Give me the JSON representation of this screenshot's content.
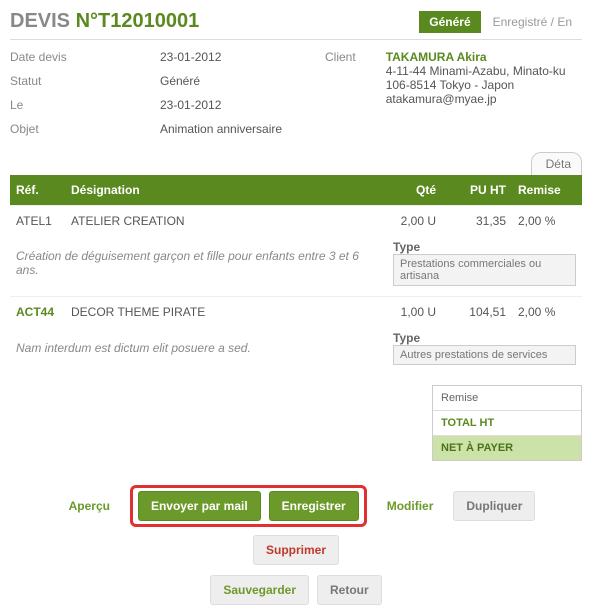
{
  "header": {
    "title_prefix": "DEVIS ",
    "title_number": "N°T12010001",
    "status_active": "Généré",
    "status_inactive": "Enregistré / En"
  },
  "meta": {
    "labels": {
      "date": "Date devis",
      "statut": "Statut",
      "le": "Le",
      "objet": "Objet",
      "client": "Client"
    },
    "values": {
      "date": "23-01-2012",
      "statut": "Généré",
      "le": "23-01-2012",
      "objet": "Animation anniversaire"
    },
    "client": {
      "name": "TAKAMURA Akira",
      "addr1": "4-11-44 Minami-Azabu, Minato-ku",
      "addr2": "106-8514 Tokyo - Japon",
      "email": "atakamura@myae.jp"
    }
  },
  "detail_tab": "Déta",
  "table": {
    "headers": {
      "ref": "Réf.",
      "des": "Désignation",
      "qte": "Qté",
      "pu": "PU HT",
      "remise": "Remise"
    },
    "type_label": "Type",
    "rows": [
      {
        "ref": "ATEL1",
        "ref_green": false,
        "des": "ATELIER CREATION",
        "qte": "2,00 U",
        "pu": "31,35",
        "remise": "2,00 %",
        "desc": "Création de déguisement garçon et fille pour enfants entre 3 et 6 ans.",
        "type": "Prestations commerciales ou artisana"
      },
      {
        "ref": "ACT44",
        "ref_green": true,
        "des": "DECOR THEME PIRATE",
        "qte": "1,00 U",
        "pu": "104,51",
        "remise": "2,00 %",
        "desc": "Nam interdum est dictum elit posuere a sed.",
        "type": "Autres prestations de services"
      }
    ]
  },
  "totals": {
    "remise": "Remise",
    "total_ht": "TOTAL HT",
    "net": "NET À PAYER"
  },
  "actions": {
    "apercu": "Aperçu",
    "envoyer": "Envoyer par mail",
    "enregistrer": "Enregistrer",
    "modifier": "Modifier",
    "dupliquer": "Dupliquer",
    "supprimer": "Supprimer",
    "sauvegarder": "Sauvegarder",
    "retour": "Retour"
  }
}
